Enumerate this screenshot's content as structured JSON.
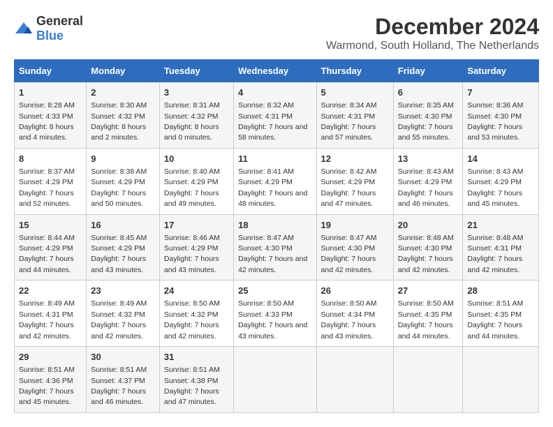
{
  "logo": {
    "general": "General",
    "blue": "Blue"
  },
  "title": "December 2024",
  "subtitle": "Warmond, South Holland, The Netherlands",
  "days_header": [
    "Sunday",
    "Monday",
    "Tuesday",
    "Wednesday",
    "Thursday",
    "Friday",
    "Saturday"
  ],
  "weeks": [
    [
      {
        "day": "1",
        "sunrise": "Sunrise: 8:28 AM",
        "sunset": "Sunset: 4:33 PM",
        "daylight": "Daylight: 8 hours and 4 minutes."
      },
      {
        "day": "2",
        "sunrise": "Sunrise: 8:30 AM",
        "sunset": "Sunset: 4:32 PM",
        "daylight": "Daylight: 8 hours and 2 minutes."
      },
      {
        "day": "3",
        "sunrise": "Sunrise: 8:31 AM",
        "sunset": "Sunset: 4:32 PM",
        "daylight": "Daylight: 8 hours and 0 minutes."
      },
      {
        "day": "4",
        "sunrise": "Sunrise: 8:32 AM",
        "sunset": "Sunset: 4:31 PM",
        "daylight": "Daylight: 7 hours and 58 minutes."
      },
      {
        "day": "5",
        "sunrise": "Sunrise: 8:34 AM",
        "sunset": "Sunset: 4:31 PM",
        "daylight": "Daylight: 7 hours and 57 minutes."
      },
      {
        "day": "6",
        "sunrise": "Sunrise: 8:35 AM",
        "sunset": "Sunset: 4:30 PM",
        "daylight": "Daylight: 7 hours and 55 minutes."
      },
      {
        "day": "7",
        "sunrise": "Sunrise: 8:36 AM",
        "sunset": "Sunset: 4:30 PM",
        "daylight": "Daylight: 7 hours and 53 minutes."
      }
    ],
    [
      {
        "day": "8",
        "sunrise": "Sunrise: 8:37 AM",
        "sunset": "Sunset: 4:29 PM",
        "daylight": "Daylight: 7 hours and 52 minutes."
      },
      {
        "day": "9",
        "sunrise": "Sunrise: 8:38 AM",
        "sunset": "Sunset: 4:29 PM",
        "daylight": "Daylight: 7 hours and 50 minutes."
      },
      {
        "day": "10",
        "sunrise": "Sunrise: 8:40 AM",
        "sunset": "Sunset: 4:29 PM",
        "daylight": "Daylight: 7 hours and 49 minutes."
      },
      {
        "day": "11",
        "sunrise": "Sunrise: 8:41 AM",
        "sunset": "Sunset: 4:29 PM",
        "daylight": "Daylight: 7 hours and 48 minutes."
      },
      {
        "day": "12",
        "sunrise": "Sunrise: 8:42 AM",
        "sunset": "Sunset: 4:29 PM",
        "daylight": "Daylight: 7 hours and 47 minutes."
      },
      {
        "day": "13",
        "sunrise": "Sunrise: 8:43 AM",
        "sunset": "Sunset: 4:29 PM",
        "daylight": "Daylight: 7 hours and 46 minutes."
      },
      {
        "day": "14",
        "sunrise": "Sunrise: 8:43 AM",
        "sunset": "Sunset: 4:29 PM",
        "daylight": "Daylight: 7 hours and 45 minutes."
      }
    ],
    [
      {
        "day": "15",
        "sunrise": "Sunrise: 8:44 AM",
        "sunset": "Sunset: 4:29 PM",
        "daylight": "Daylight: 7 hours and 44 minutes."
      },
      {
        "day": "16",
        "sunrise": "Sunrise: 8:45 AM",
        "sunset": "Sunset: 4:29 PM",
        "daylight": "Daylight: 7 hours and 43 minutes."
      },
      {
        "day": "17",
        "sunrise": "Sunrise: 8:46 AM",
        "sunset": "Sunset: 4:29 PM",
        "daylight": "Daylight: 7 hours and 43 minutes."
      },
      {
        "day": "18",
        "sunrise": "Sunrise: 8:47 AM",
        "sunset": "Sunset: 4:30 PM",
        "daylight": "Daylight: 7 hours and 42 minutes."
      },
      {
        "day": "19",
        "sunrise": "Sunrise: 8:47 AM",
        "sunset": "Sunset: 4:30 PM",
        "daylight": "Daylight: 7 hours and 42 minutes."
      },
      {
        "day": "20",
        "sunrise": "Sunrise: 8:48 AM",
        "sunset": "Sunset: 4:30 PM",
        "daylight": "Daylight: 7 hours and 42 minutes."
      },
      {
        "day": "21",
        "sunrise": "Sunrise: 8:48 AM",
        "sunset": "Sunset: 4:31 PM",
        "daylight": "Daylight: 7 hours and 42 minutes."
      }
    ],
    [
      {
        "day": "22",
        "sunrise": "Sunrise: 8:49 AM",
        "sunset": "Sunset: 4:31 PM",
        "daylight": "Daylight: 7 hours and 42 minutes."
      },
      {
        "day": "23",
        "sunrise": "Sunrise: 8:49 AM",
        "sunset": "Sunset: 4:32 PM",
        "daylight": "Daylight: 7 hours and 42 minutes."
      },
      {
        "day": "24",
        "sunrise": "Sunrise: 8:50 AM",
        "sunset": "Sunset: 4:32 PM",
        "daylight": "Daylight: 7 hours and 42 minutes."
      },
      {
        "day": "25",
        "sunrise": "Sunrise: 8:50 AM",
        "sunset": "Sunset: 4:33 PM",
        "daylight": "Daylight: 7 hours and 43 minutes."
      },
      {
        "day": "26",
        "sunrise": "Sunrise: 8:50 AM",
        "sunset": "Sunset: 4:34 PM",
        "daylight": "Daylight: 7 hours and 43 minutes."
      },
      {
        "day": "27",
        "sunrise": "Sunrise: 8:50 AM",
        "sunset": "Sunset: 4:35 PM",
        "daylight": "Daylight: 7 hours and 44 minutes."
      },
      {
        "day": "28",
        "sunrise": "Sunrise: 8:51 AM",
        "sunset": "Sunset: 4:35 PM",
        "daylight": "Daylight: 7 hours and 44 minutes."
      }
    ],
    [
      {
        "day": "29",
        "sunrise": "Sunrise: 8:51 AM",
        "sunset": "Sunset: 4:36 PM",
        "daylight": "Daylight: 7 hours and 45 minutes."
      },
      {
        "day": "30",
        "sunrise": "Sunrise: 8:51 AM",
        "sunset": "Sunset: 4:37 PM",
        "daylight": "Daylight: 7 hours and 46 minutes."
      },
      {
        "day": "31",
        "sunrise": "Sunrise: 8:51 AM",
        "sunset": "Sunset: 4:38 PM",
        "daylight": "Daylight: 7 hours and 47 minutes."
      },
      null,
      null,
      null,
      null
    ]
  ]
}
